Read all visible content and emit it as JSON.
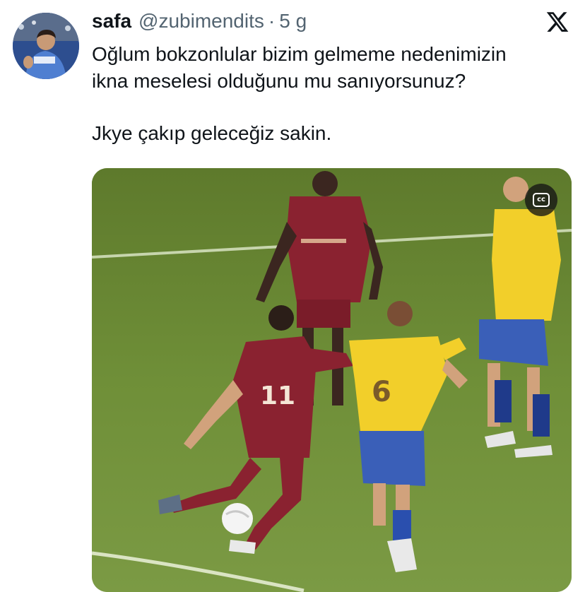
{
  "tweet": {
    "author_name": "safa",
    "author_handle": "@zubimendits",
    "separator": "·",
    "time": "5 g",
    "text_line_1": "Oğlum bokzonlular bizim gelmeme nedenimizin",
    "text_line_2": "ikna meselesi olduğunu mu sanıyorsunuz?",
    "text_line_3": "Jkye çakıp geleceğiz sakin."
  },
  "media": {
    "cc_label": "cc",
    "player_number_left": "11",
    "player_number_right": "6"
  },
  "icons": {
    "platform": "x-logo-icon",
    "captions": "closed-captions-icon"
  },
  "colors": {
    "text": "#0f1419",
    "secondary": "#536471",
    "pitch": "#6f8a3a",
    "maroon_kit": "#8a2230",
    "yellow_kit": "#f2cf2a",
    "blue_shorts": "#3a5fb8"
  }
}
